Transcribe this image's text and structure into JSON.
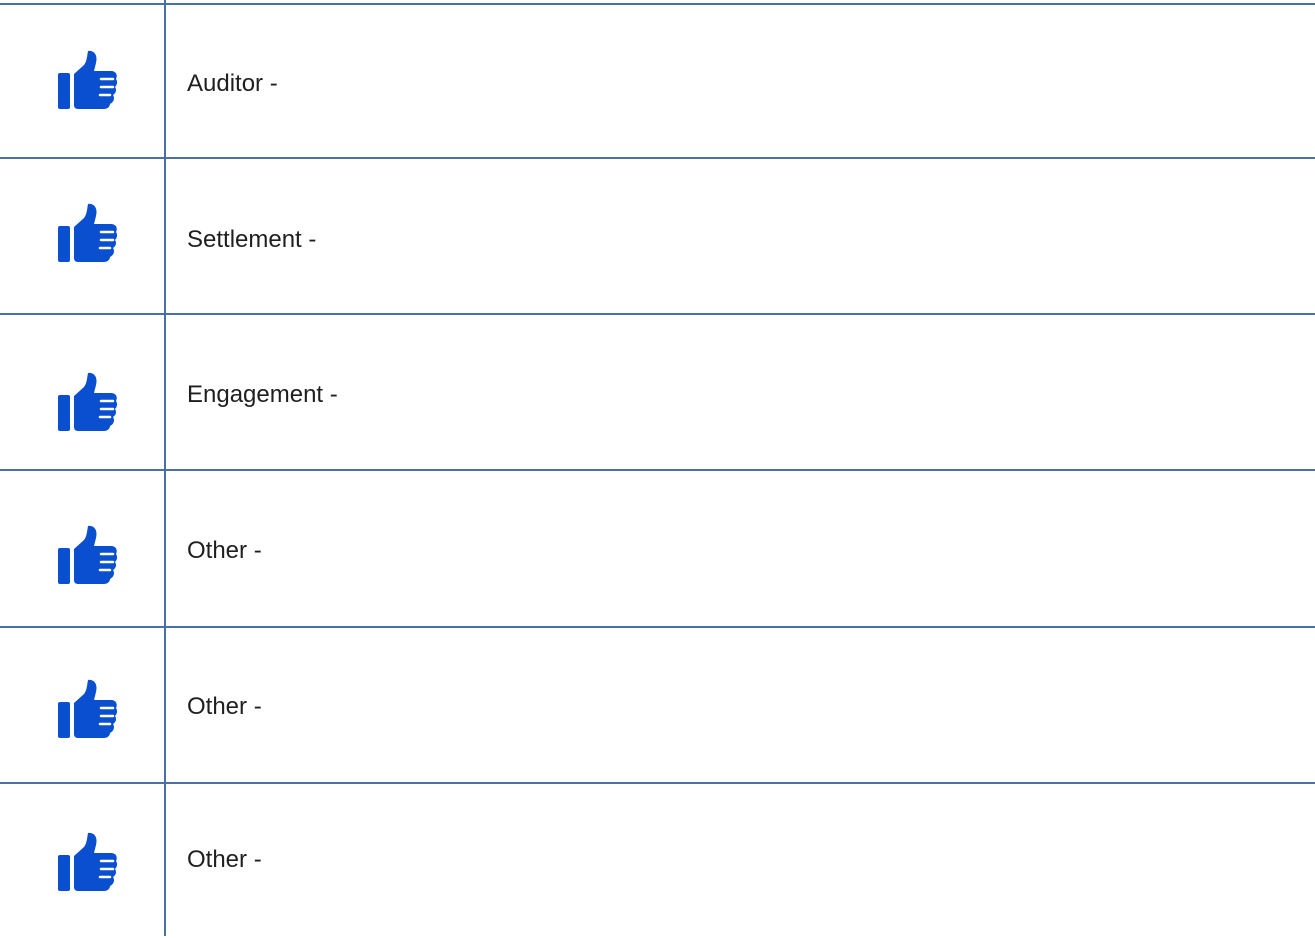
{
  "accent_color": "#0b4fd1",
  "rows": [
    {
      "label": "Auditor -",
      "icon": "thumbs-up-icon"
    },
    {
      "label": "Settlement -",
      "icon": "thumbs-up-icon"
    },
    {
      "label": "Engagement -",
      "icon": "thumbs-up-icon"
    },
    {
      "label": "Other -",
      "icon": "thumbs-up-icon"
    },
    {
      "label": "Other -",
      "icon": "thumbs-up-icon"
    },
    {
      "label": "Other -",
      "icon": "thumbs-up-icon"
    }
  ]
}
